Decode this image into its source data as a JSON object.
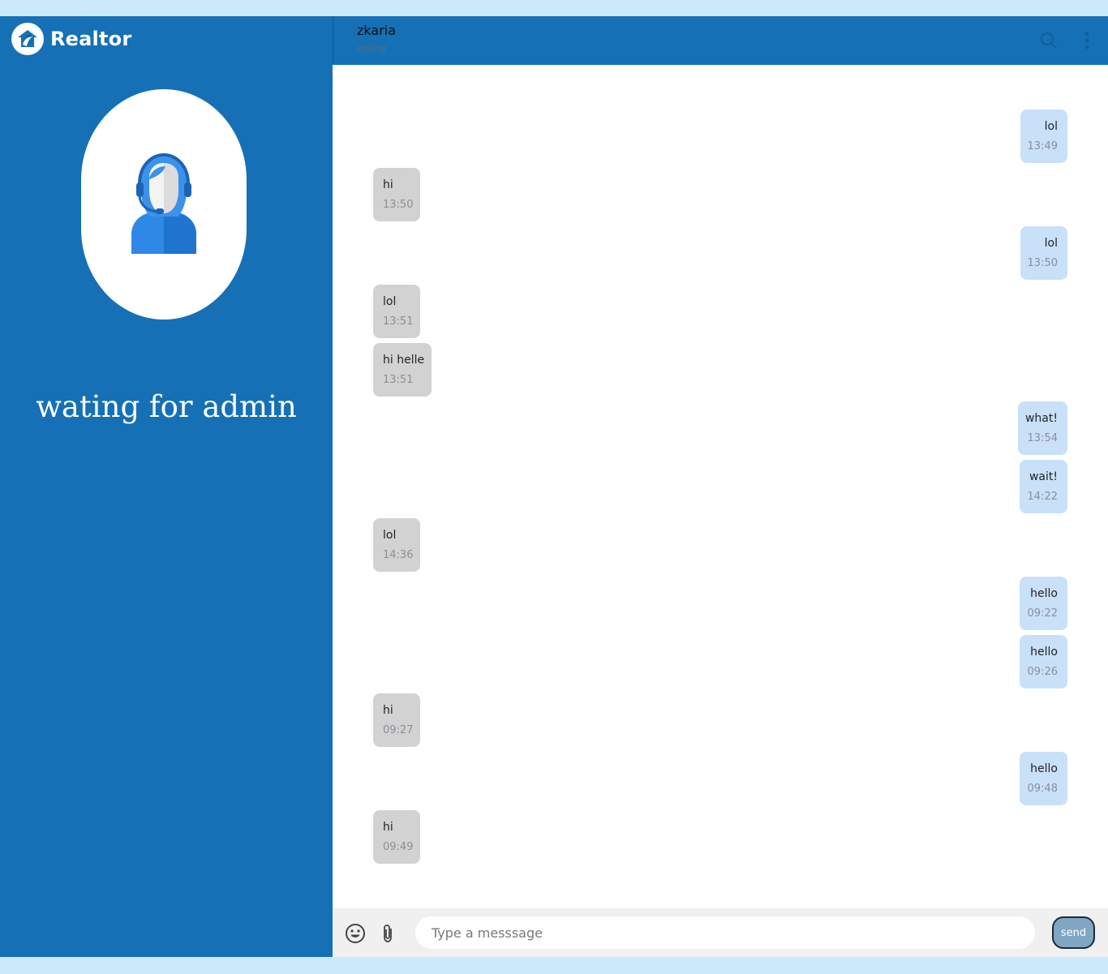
{
  "brand": {
    "name": "Realtor",
    "logo_icon": "realtor-house-icon"
  },
  "sidebar": {
    "avatar_icon": "support-agent-icon",
    "waiting_text": "wating for admin"
  },
  "header": {
    "contact_name": "zkaria",
    "contact_status": "online",
    "search_icon": "search-icon",
    "menu_icon": "more-vertical-icon"
  },
  "messages": [
    {
      "dir": "out",
      "text": "lol",
      "time": "13:49"
    },
    {
      "dir": "in",
      "text": "hi",
      "time": "13:50"
    },
    {
      "dir": "out",
      "text": "lol",
      "time": "13:50"
    },
    {
      "dir": "in",
      "text": "lol",
      "time": "13:51"
    },
    {
      "dir": "in",
      "text": "hi helle",
      "time": "13:51"
    },
    {
      "dir": "out",
      "text": "what!",
      "time": "13:54"
    },
    {
      "dir": "out",
      "text": "wait!",
      "time": "14:22"
    },
    {
      "dir": "in",
      "text": "lol",
      "time": "14:36"
    },
    {
      "dir": "out",
      "text": "hello",
      "time": "09:22"
    },
    {
      "dir": "out",
      "text": "hello",
      "time": "09:26"
    },
    {
      "dir": "in",
      "text": "hi",
      "time": "09:27"
    },
    {
      "dir": "out",
      "text": "hello",
      "time": "09:48"
    },
    {
      "dir": "in",
      "text": "hi",
      "time": "09:49"
    }
  ],
  "composer": {
    "emoji_icon": "emoji-icon",
    "attach_icon": "paperclip-icon",
    "placeholder": "Type a messsage",
    "value": "",
    "send_label": "send"
  },
  "colors": {
    "primary": "#1570b6",
    "page_bg": "#cce8fb",
    "incoming_bubble": "#d2d2d2",
    "outgoing_bubble": "#c9e0f9",
    "send_button": "#7fa7c4"
  }
}
